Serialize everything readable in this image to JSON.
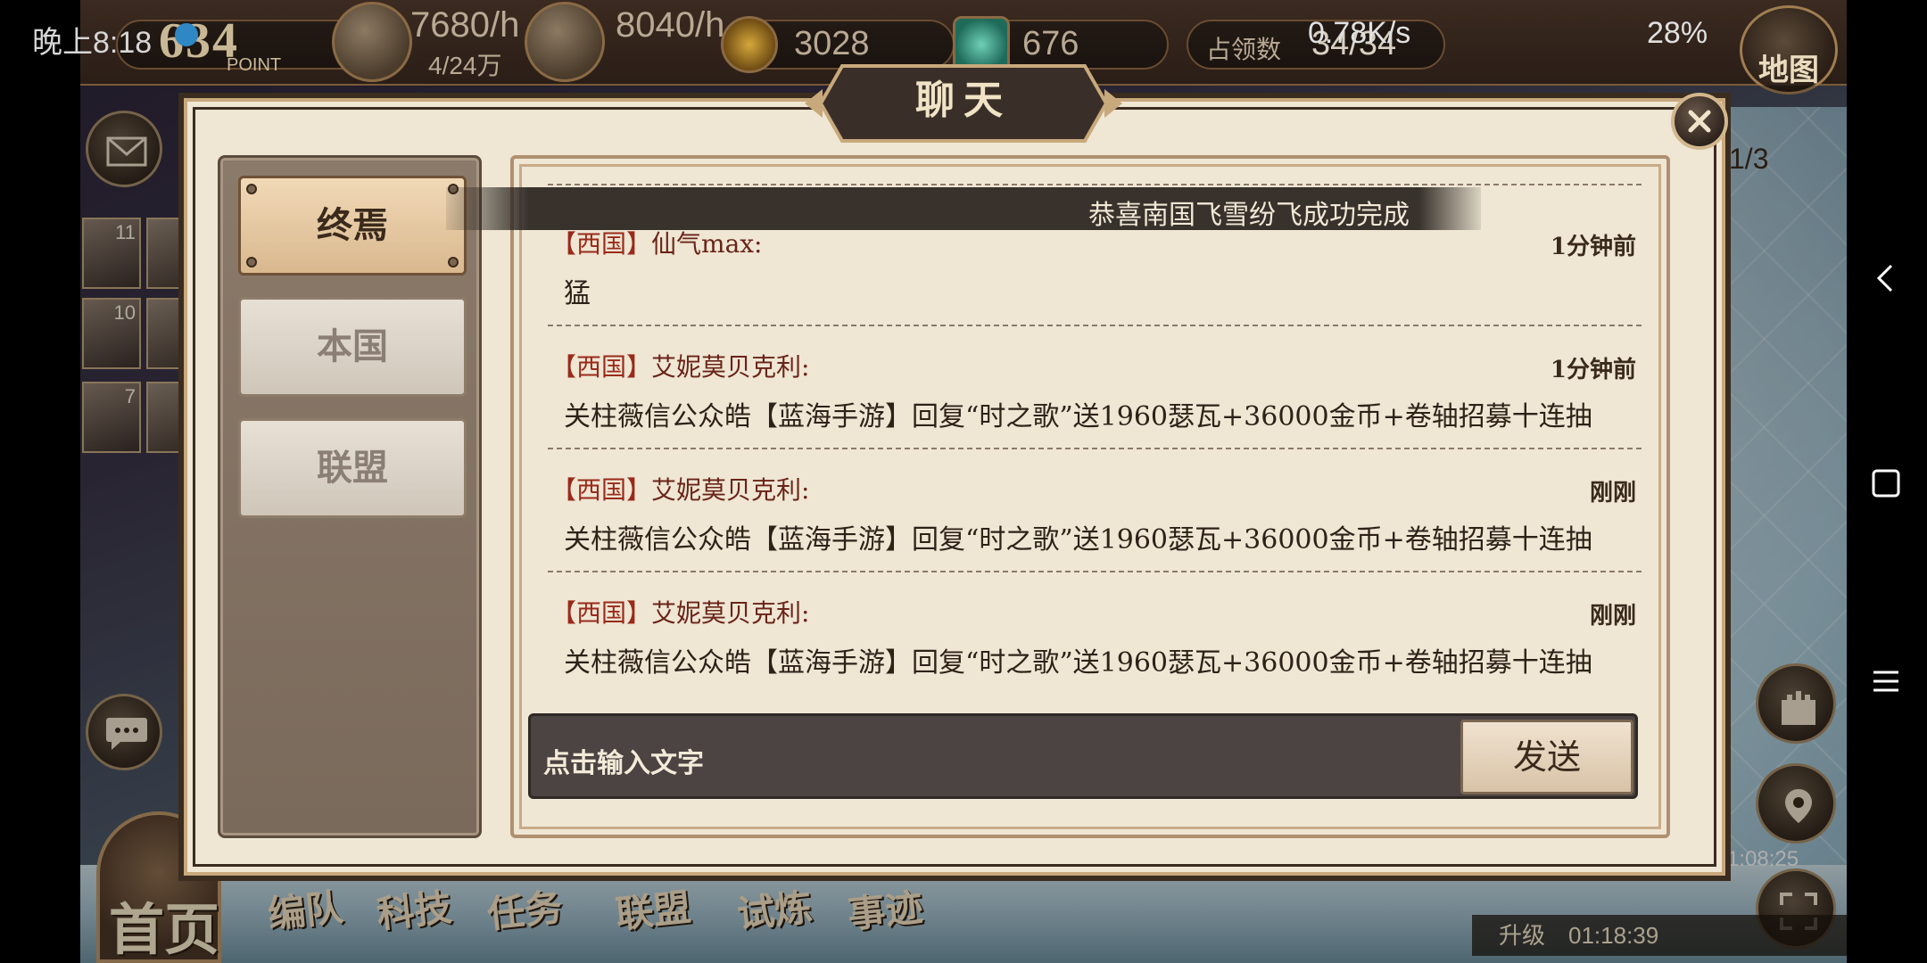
{
  "status_bar": {
    "time": "晚上8:18",
    "net_speed": "0.78K/s",
    "battery": "28%"
  },
  "top_hud": {
    "points": "634",
    "points_label": "POINT",
    "resource1_rate": "7680/h",
    "resource1_total": "4/24万",
    "resource2_rate": "8040/h",
    "currency_gold": "3028",
    "currency_gem": "676",
    "occupied_label": "占领数",
    "occupied_value": "34/34",
    "map_button": "地图"
  },
  "side": {
    "hero_counts": [
      "11",
      "10",
      "7"
    ],
    "page_indicator": "1/3",
    "timer": "1:08:25"
  },
  "upgrade": {
    "label": "升级",
    "time": "01:18:39"
  },
  "bottom_nav": {
    "home": "首页",
    "items": [
      "编队",
      "科技",
      "任务",
      "联盟",
      "试炼",
      "事迹"
    ]
  },
  "chat": {
    "title": "聊天",
    "tabs": [
      "终焉",
      "本国",
      "联盟"
    ],
    "active_tab": 0,
    "banner": "恭喜南国飞雪纷飞成功完成",
    "messages": [
      {
        "nation": "【西国】",
        "user": "仙气max:",
        "time": "1分钟前",
        "text": "猛"
      },
      {
        "nation": "【西国】",
        "user": "艾妮莫贝克利:",
        "time": "1分钟前",
        "text": "关柱薇信公众皓【蓝海手游】回复“时之歌”送1960瑟瓦+36000金币+卷轴招募十连抽"
      },
      {
        "nation": "【西国】",
        "user": "艾妮莫贝克利:",
        "time": "刚刚",
        "text": "关柱薇信公众皓【蓝海手游】回复“时之歌”送1960瑟瓦+36000金币+卷轴招募十连抽"
      },
      {
        "nation": "【西国】",
        "user": "艾妮莫贝克利:",
        "time": "刚刚",
        "text": "关柱薇信公众皓【蓝海手游】回复“时之歌”送1960瑟瓦+36000金币+卷轴招募十连抽"
      }
    ],
    "input_placeholder": "点击输入文字",
    "send_label": "发送"
  },
  "colors": {
    "panel_bg": "#efe6d4",
    "nation_red": "#9a2a1a",
    "frame_dark": "#3b2c20"
  }
}
